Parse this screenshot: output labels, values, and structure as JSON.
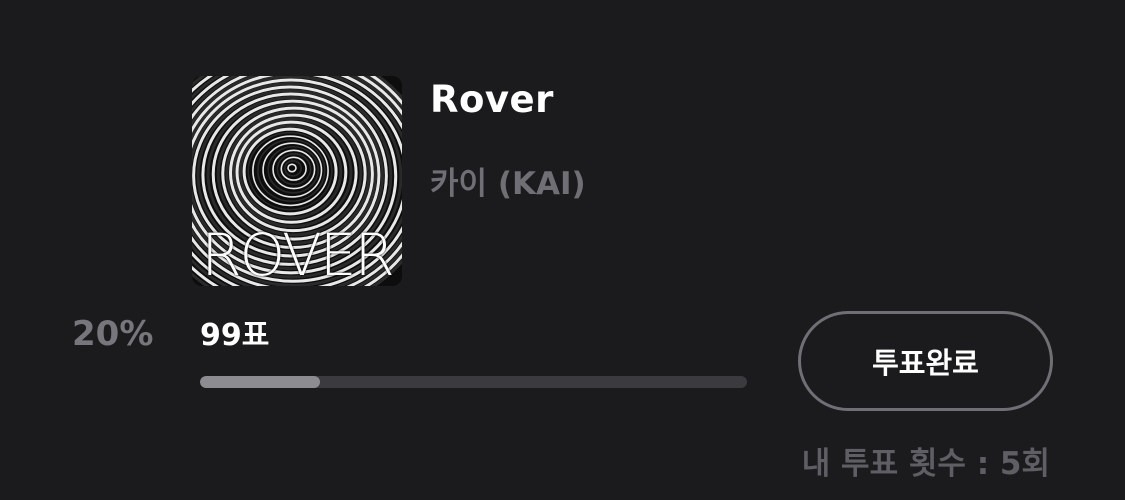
{
  "song": {
    "title": "Rover",
    "artist": "카이 (KAI)",
    "album_cover_text": "ROVER",
    "album_cover_icon": "spiral-album-art"
  },
  "stats": {
    "percent_label": "20%",
    "percent_value": 20,
    "votes_label": "99표",
    "progress_fraction": 0.22
  },
  "actions": {
    "vote_button_label": "투표완료"
  },
  "footer": {
    "my_vote_count": "내 투표 횟수 : 5회"
  },
  "colors": {
    "background": "#1b1b1d",
    "text_primary": "#ffffff",
    "text_secondary": "#6f6f75",
    "progress_track": "#3a3a3f",
    "progress_fill": "#8c8c91",
    "button_border": "#6f6f75"
  }
}
